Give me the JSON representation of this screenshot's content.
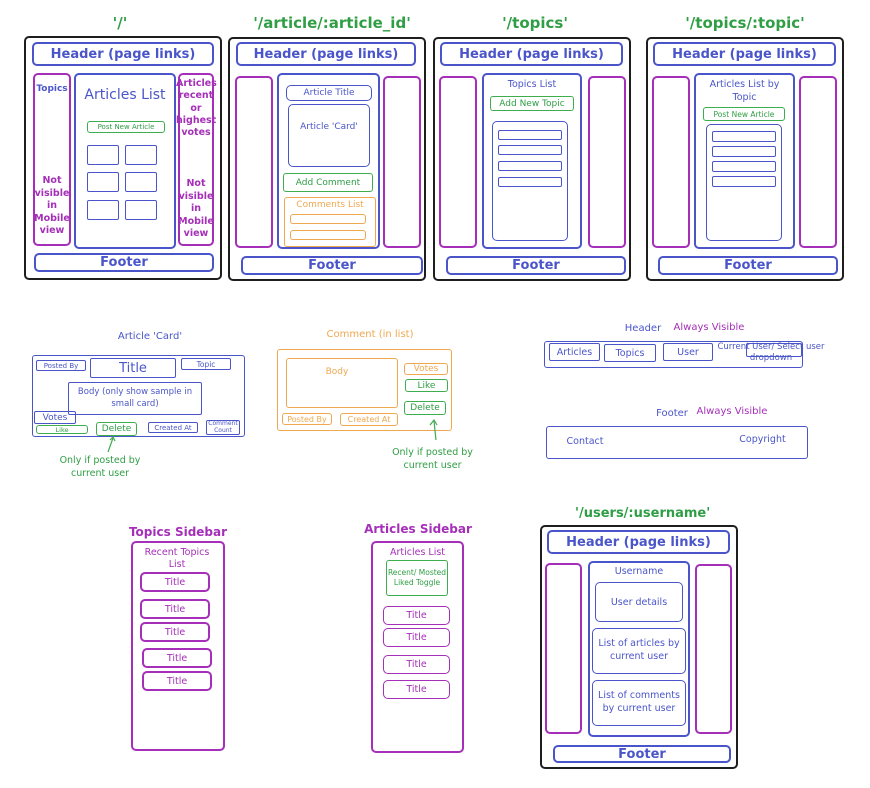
{
  "routes": {
    "home": "'/'",
    "article": "'/article/:article_id'",
    "topics": "'/topics'",
    "topic": "'/topics/:topic'",
    "user": "'/users/:username'"
  },
  "common": {
    "header": "Header (page links)",
    "footer": "Footer"
  },
  "home": {
    "topics": "Topics",
    "articles_list": "Articles List",
    "post_new": "Post New Article",
    "side_articles": "Articles recent or highest votes",
    "not_visible": "Not visible in Mobile view"
  },
  "article": {
    "title": "Article Title",
    "card": "Article 'Card'",
    "add_comment": "Add Comment",
    "comments_list": "Comments List"
  },
  "topics": {
    "list": "Topics List",
    "add_new": "Add New Topic"
  },
  "topic": {
    "list": "Articles List by Topic",
    "post_new": "Post New Article"
  },
  "card": {
    "heading": "Article 'Card'",
    "posted_by": "Posted By",
    "title": "Title",
    "topic": "Topic",
    "body": "Body (only show sample in small card)",
    "votes": "Votes",
    "like": "Like",
    "delete": "Delete",
    "created_at": "Created At",
    "comment_count": "Comment Count",
    "note": "Only if posted by current user"
  },
  "comment": {
    "heading": "Comment (in list)",
    "body": "Body",
    "votes": "Votes",
    "like": "Like",
    "delete": "Delete",
    "posted_by": "Posted By",
    "created_at": "Created At",
    "note": "Only if posted by current user"
  },
  "header_spec": {
    "label": "Header",
    "always": "Always Visible",
    "articles": "Articles",
    "topics": "Topics",
    "user": "User",
    "current_user": "Current User/ Select user dropdown"
  },
  "footer_spec": {
    "label": "Footer",
    "always": "Always Visible",
    "contact": "Contact",
    "copyright": "Copyright"
  },
  "topics_sidebar": {
    "heading": "Topics Sidebar",
    "recent": "Recent Topics List",
    "items": [
      "Title",
      "Title",
      "Title",
      "Title",
      "Title"
    ]
  },
  "articles_sidebar": {
    "heading": "Articles Sidebar",
    "list": "Articles List",
    "toggle": "Recent/ Mosted Liked Toggle",
    "items": [
      "Title",
      "Title",
      "Title",
      "Title"
    ]
  },
  "user_page": {
    "username": "Username",
    "details": "User details",
    "articles": "List of articles by current user",
    "comments": "List of comments by current user"
  }
}
